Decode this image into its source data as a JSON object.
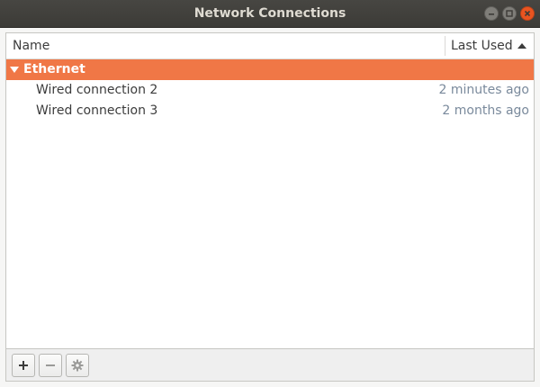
{
  "window": {
    "title": "Network Connections"
  },
  "list": {
    "columns": {
      "name": "Name",
      "last_used": "Last Used"
    },
    "sort": "ascending",
    "group": {
      "label": "Ethernet",
      "expanded": true
    },
    "rows": [
      {
        "name": "Wired connection 2",
        "last_used": "2 minutes ago"
      },
      {
        "name": "Wired connection 3",
        "last_used": "2 months ago"
      }
    ]
  },
  "toolbar": {
    "buttons": [
      "add-icon",
      "remove-icon",
      "gear-icon"
    ]
  },
  "colors": {
    "accent": "#f07746",
    "close": "#e95420",
    "title_bar": "#3c3b37"
  }
}
